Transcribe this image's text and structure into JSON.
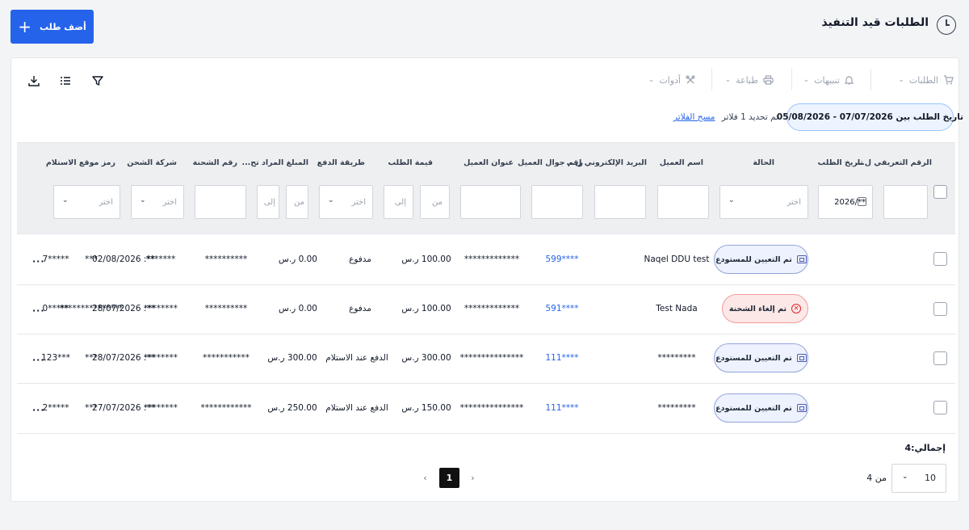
{
  "header": {
    "title": "الطلبات قيد التنفيذ",
    "add_button": "أضف طلب"
  },
  "toolbar": {
    "orders": "الطلبات",
    "alerts": "تنبيهات",
    "print": "طباعة",
    "tools": "أدوات"
  },
  "filters": {
    "date_range": "تاريخ الطلب بين 07/07/2026 - 05/08/2026",
    "selected_count": "تم تحديد 1 فلاتر",
    "clear": "مسح الفلاتر"
  },
  "columns": [
    "الرقم التعريفي ل...",
    "تاريخ الطلب",
    "الحالة",
    "اسم العميل",
    "البريد الإلكتروني ل...",
    "رقم جوال العميل",
    "عنوان العميل",
    "قيمة الطلب",
    "طريقة الدفع",
    "المبلغ المراد تح...",
    "رقم الشحنة",
    "شركة الشحن",
    "رمز موقع الاستلام"
  ],
  "filter_inputs": {
    "date_value": "**/2026",
    "select_placeholder": "اختر",
    "from": "من",
    "to": "إلى"
  },
  "rows": [
    {
      "id": "*****7",
      "date": "**: 02/08/2026",
      "status": "تم التعيين للمستودع",
      "status_type": "assigned",
      "customer": "Naqel DDU test",
      "email": "",
      "phone": "****599",
      "address": "*************",
      "value": "100.00 ر.س",
      "payment": "مدفوع",
      "cod": "0.00 ر.س",
      "shipment": "**********",
      "carrier": "*******",
      "pickup": "***"
    },
    {
      "id": "*****0",
      "date": "**: 28/07/2026",
      "status": "تم إلغاء الشحنة",
      "status_type": "cancelled",
      "customer": "Test Nada",
      "email": "",
      "phone": "****591",
      "address": "*************",
      "value": "100.00 ر.س",
      "payment": "مدفوع",
      "cod": "0.00 ر.س",
      "shipment": "**********",
      "carrier": "********",
      "pickup": "***************"
    },
    {
      "id": "***123",
      "date": "**: 28/07/2026",
      "status": "تم التعيين للمستودع",
      "status_type": "assigned",
      "customer": "*********",
      "email": "",
      "phone": "****111",
      "address": "***************",
      "value": "300.00 ر.س",
      "payment": "الدفع عند الاستلام",
      "cod": "300.00 ر.س",
      "shipment": "***********",
      "carrier": "********",
      "pickup": "***"
    },
    {
      "id": "*****2",
      "date": "**: 27/07/2026",
      "status": "تم التعيين للمستودع",
      "status_type": "assigned",
      "customer": "*********",
      "email": "",
      "phone": "****111",
      "address": "***************",
      "value": "150.00 ر.س",
      "payment": "الدفع عند الاستلام",
      "cod": "250.00 ر.س",
      "shipment": "************",
      "carrier": "********",
      "pickup": "***"
    }
  ],
  "footer": {
    "total": "إجمالي:4",
    "page_size": "10",
    "of": "من 4",
    "current_page": "1",
    "more": "..."
  },
  "icons": {
    "clock": "clock-icon",
    "cart": "cart-icon",
    "bell": "bell-icon",
    "printer": "printer-icon",
    "tools": "tools-icon",
    "filter": "filter-icon",
    "list": "list-icon",
    "download": "download-icon",
    "warehouse": "warehouse-icon",
    "cancel": "x-circle-icon"
  },
  "colors": {
    "primary": "#2563eb",
    "assigned_badge": "#eef2ff",
    "cancelled_badge": "#fde8e8",
    "link": "#2563eb"
  }
}
